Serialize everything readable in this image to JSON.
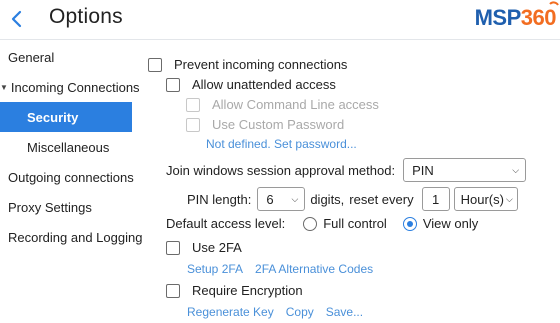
{
  "header": {
    "title": "Options",
    "logo_msp": "MSP",
    "logo_360": "360",
    "back_icon": "chevron-left-icon"
  },
  "colors": {
    "accent": "#2b7fe0",
    "link": "#4a90d9",
    "logo_blue": "#1f5fae",
    "logo_orange": "#f26d21"
  },
  "sidebar": {
    "items": [
      {
        "label": "General"
      },
      {
        "label": "Incoming Connections",
        "expanded": true
      },
      {
        "label": "Security",
        "active": true
      },
      {
        "label": "Miscellaneous"
      },
      {
        "label": "Outgoing connections"
      },
      {
        "label": "Proxy Settings"
      },
      {
        "label": "Recording and Logging"
      }
    ]
  },
  "security": {
    "prevent_incoming": {
      "label": "Prevent incoming connections",
      "checked": false
    },
    "allow_unattended": {
      "label": "Allow unattended access",
      "checked": false
    },
    "allow_cmd": {
      "label": "Allow Command Line access",
      "checked": false,
      "disabled": true
    },
    "use_custom_pw": {
      "label": "Use Custom Password",
      "checked": false,
      "disabled": true
    },
    "password_link": "Not defined. Set password...",
    "join_method": {
      "label": "Join windows session approval method:",
      "value": "PIN"
    },
    "pin": {
      "length_label": "PIN length:",
      "length_value": "6",
      "digits_label": "digits,",
      "reset_label": "reset every",
      "reset_value": "1",
      "unit_value": "Hour(s)"
    },
    "access_level": {
      "label": "Default access level:",
      "options": [
        {
          "label": "Full control",
          "selected": false
        },
        {
          "label": "View only",
          "selected": true
        }
      ]
    },
    "use_2fa": {
      "label": "Use 2FA",
      "checked": false
    },
    "twofa_links": {
      "setup": "Setup 2FA",
      "alt_codes": "2FA Alternative Codes"
    },
    "require_encryption": {
      "label": "Require Encryption",
      "checked": false
    },
    "encryption_links": {
      "regen": "Regenerate Key",
      "copy": "Copy",
      "save": "Save..."
    }
  }
}
